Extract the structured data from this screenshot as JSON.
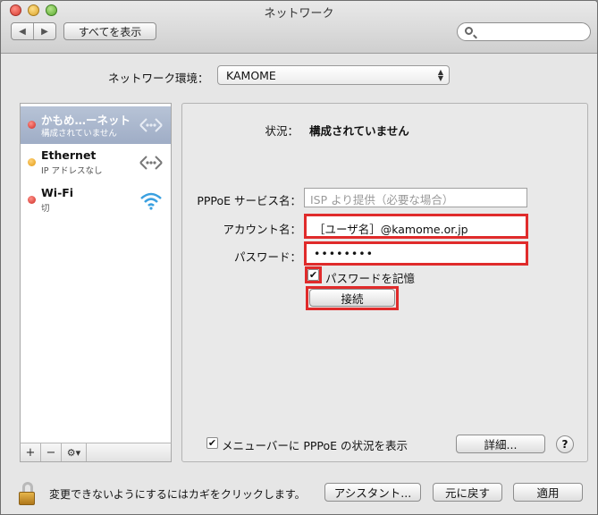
{
  "window": {
    "title": "ネットワーク",
    "nav_back": "◀",
    "nav_forward": "▶",
    "show_all": "すべてを表示",
    "search_placeholder": ""
  },
  "location": {
    "label": "ネットワーク環境：",
    "value": "KAMOME"
  },
  "services": [
    {
      "name": "かもめ…ーネット",
      "status": "構成されていません",
      "dot": "red",
      "icon": "connection-arrows-icon",
      "selected": true
    },
    {
      "name": "Ethernet",
      "status": "IP アドレスなし",
      "dot": "amber",
      "icon": "connection-arrows-icon",
      "selected": false
    },
    {
      "name": "Wi-Fi",
      "status": "切",
      "dot": "red",
      "icon": "wifi-icon",
      "selected": false
    }
  ],
  "sidebar_controls": {
    "add": "+",
    "remove": "−",
    "gear": "⚙▾"
  },
  "panel": {
    "status_label": "状況：",
    "status_value": "構成されていません",
    "pppoe_label": "PPPoE サービス名：",
    "pppoe_placeholder": "ISP より提供（必要な場合）",
    "account_label": "アカウント名：",
    "account_value": "［ユーザ名］@kamome.or.jp",
    "password_label": "パスワード：",
    "password_value": "••••••••",
    "remember_label": "パスワードを記憶",
    "remember_checked": true,
    "connect_button": "接続",
    "menubar_label": "メニューバーに PPPoE の状況を表示",
    "menubar_checked": true,
    "advanced_button": "詳細...",
    "help_button": "?"
  },
  "footer": {
    "lock_text": "変更できないようにするにはカギをクリックします。",
    "assistant_button": "アシスタント...",
    "revert_button": "元に戻す",
    "apply_button": "適用"
  },
  "colors": {
    "highlight": "#e02b2b",
    "selection": "#a9b6cc",
    "status_red": "#cc2a22",
    "status_amber": "#e29a10"
  }
}
